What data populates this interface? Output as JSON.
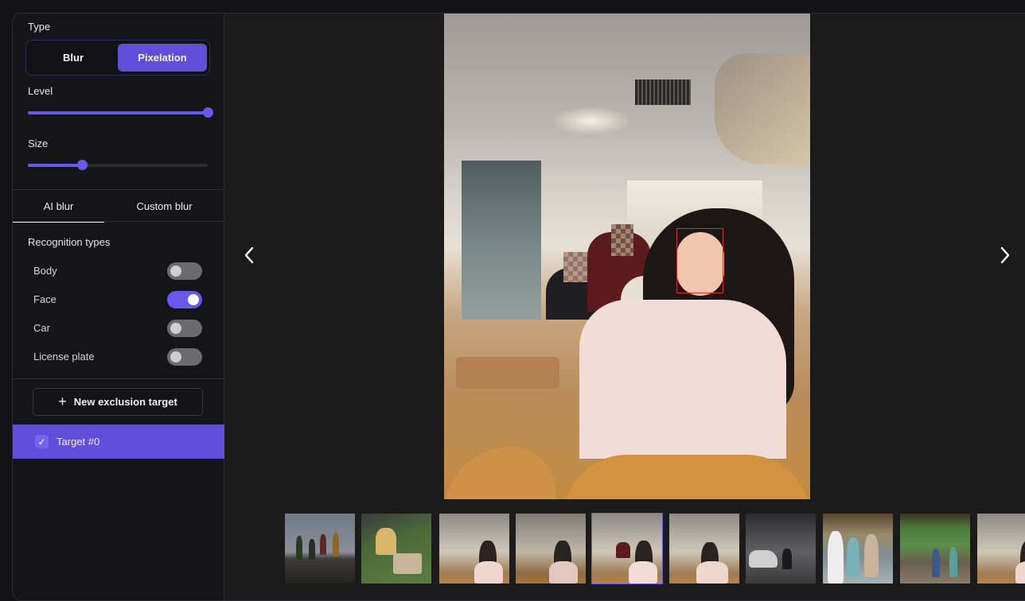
{
  "sidebar": {
    "type": {
      "label": "Type",
      "options": [
        "Blur",
        "Pixelation"
      ],
      "selected": "Pixelation"
    },
    "level": {
      "label": "Level",
      "value_fraction": 1.0
    },
    "size": {
      "label": "Size",
      "value_fraction": 0.3
    },
    "tabs": [
      {
        "label": "AI blur",
        "active": true
      },
      {
        "label": "Custom blur",
        "active": false
      }
    ],
    "recognition": {
      "title": "Recognition types",
      "items": [
        {
          "label": "Body",
          "on": false
        },
        {
          "label": "Face",
          "on": true
        },
        {
          "label": "Car",
          "on": false
        },
        {
          "label": "License plate",
          "on": false
        }
      ]
    },
    "new_exclusion_label": "New exclusion target",
    "targets": [
      {
        "label": "Target #0",
        "checked": true
      }
    ]
  },
  "viewer": {
    "prev_icon": "chevron-left-icon",
    "next_icon": "chevron-right-icon",
    "main_image": "cafe scene, woman taking selfie, background faces pixelated",
    "detection_box_color": "#e02a2a",
    "thumbnails": [
      {
        "scene": "group jumping on beach rocks",
        "selected": false
      },
      {
        "scene": "people sitting on grass with box",
        "selected": false
      },
      {
        "scene": "cafe selfie",
        "selected": false
      },
      {
        "scene": "cafe selfie (dim)",
        "selected": false
      },
      {
        "scene": "cafe selfie",
        "selected": true
      },
      {
        "scene": "cafe selfie",
        "selected": false
      },
      {
        "scene": "parking garage with car",
        "selected": false
      },
      {
        "scene": "street festival crowd",
        "selected": false
      },
      {
        "scene": "outdoor market",
        "selected": false
      },
      {
        "scene": "cafe selfie",
        "selected": false
      }
    ]
  },
  "colors": {
    "accent": "#624ddb",
    "accent_bright": "#6a57f0",
    "sidebar_bg": "#151517",
    "viewer_bg": "#1b1b1c",
    "page_bg": "#131316"
  }
}
